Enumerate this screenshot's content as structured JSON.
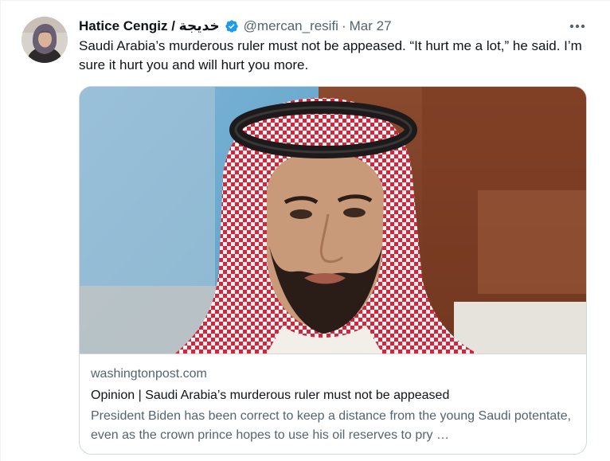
{
  "tweet": {
    "author": {
      "display_name": "Hatice Cengiz / خديجة",
      "verified": true,
      "handle": "@mercan_resifi"
    },
    "separator": "·",
    "date": "Mar 27",
    "text": "Saudi Arabia’s murderous ruler must not be appeased. “It hurt me a lot,” he said. I’m sure it hurt you and will hurt you more.",
    "more_icon": "ellipsis-icon",
    "card": {
      "domain": "washingtonpost.com",
      "title": "Opinion | Saudi Arabia’s murderous ruler must not be appeased",
      "description": "President Biden has been correct to keep a distance from the young Saudi potentate, even as the crown prince hopes to use his oil reserves to pry …"
    }
  },
  "colors": {
    "verified_badge": "#1d9bf0",
    "secondary_text": "#536471",
    "card_border": "#cfd9de"
  }
}
